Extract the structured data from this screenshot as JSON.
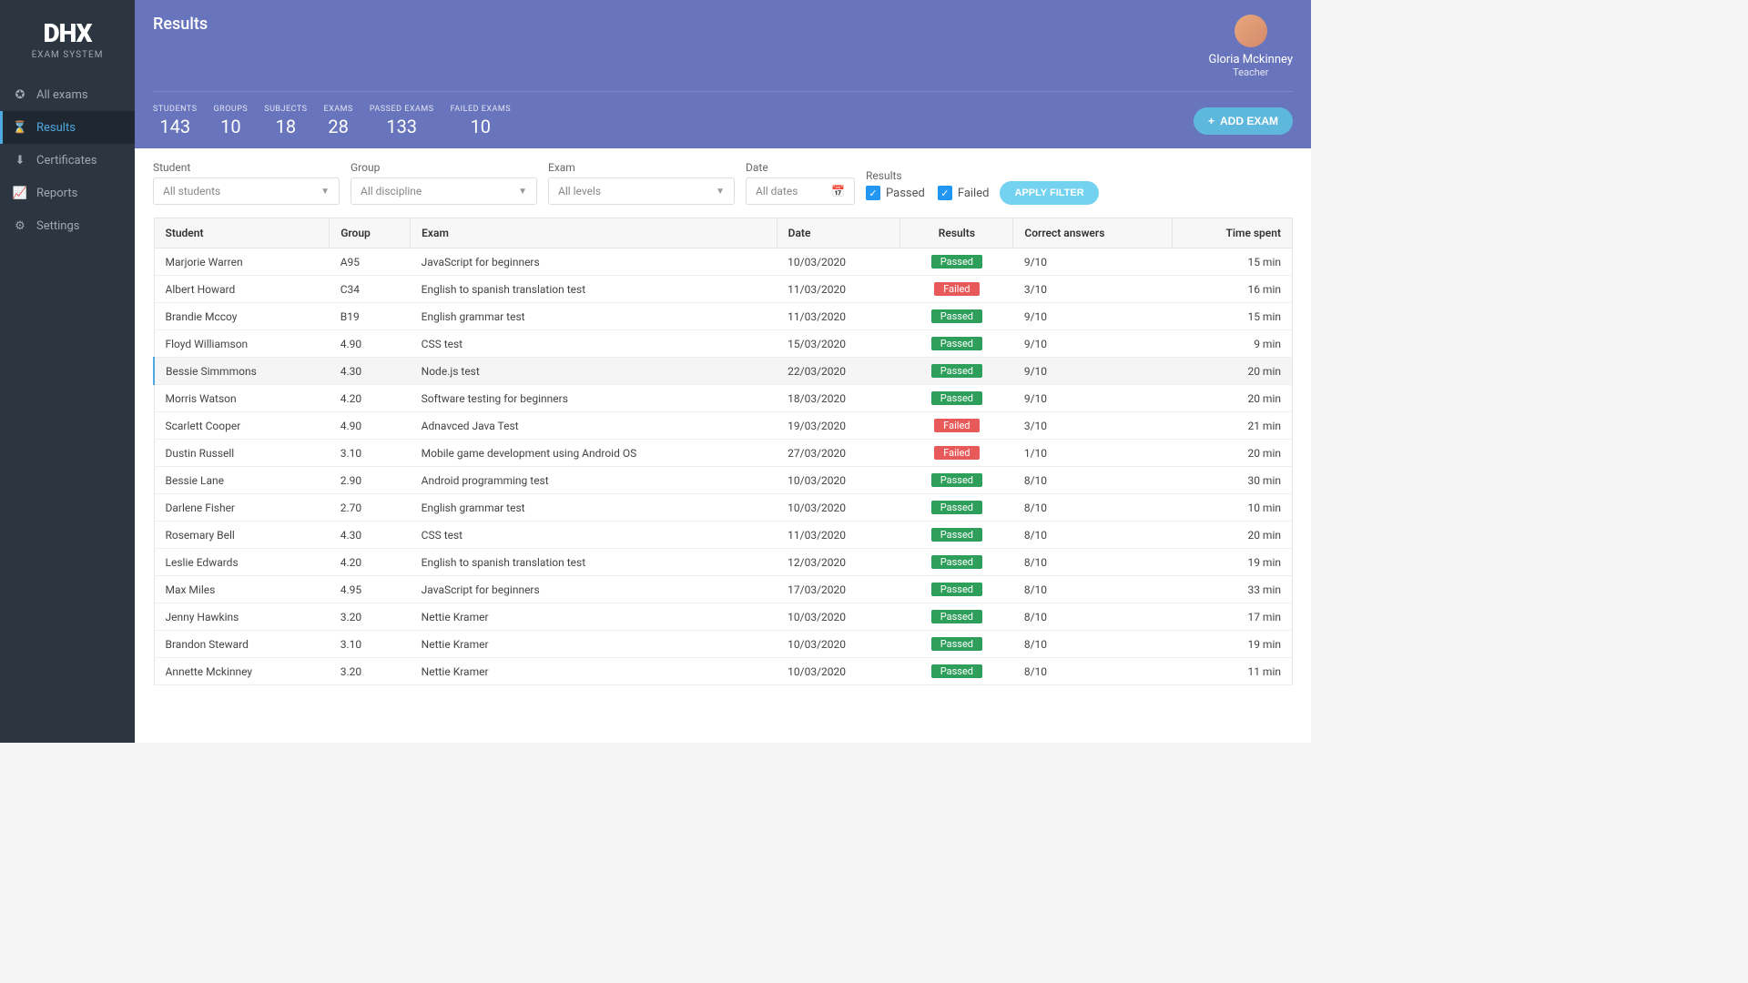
{
  "brand": {
    "logo": "DHX",
    "sub": "EXAM SYSTEM"
  },
  "nav": {
    "all_exams": "All exams",
    "results": "Results",
    "certificates": "Certificates",
    "reports": "Reports",
    "settings": "Settings"
  },
  "header": {
    "title": "Results",
    "add_exam": "ADD EXAM",
    "user": {
      "name": "Gloria Mckinney",
      "role": "Teacher"
    }
  },
  "stats": [
    {
      "label": "STUDENTS",
      "value": "143"
    },
    {
      "label": "GROUPS",
      "value": "10"
    },
    {
      "label": "SUBJECTS",
      "value": "18"
    },
    {
      "label": "EXAMS",
      "value": "28"
    },
    {
      "label": "PASSED EXAMS",
      "value": "133"
    },
    {
      "label": "FAILED EXAMS",
      "value": "10"
    }
  ],
  "filters": {
    "student": {
      "label": "Student",
      "value": "All students"
    },
    "group": {
      "label": "Group",
      "value": "All discipline"
    },
    "exam": {
      "label": "Exam",
      "value": "All levels"
    },
    "date": {
      "label": "Date",
      "value": "All dates"
    },
    "results": {
      "label": "Results",
      "passed": "Passed",
      "failed": "Failed"
    },
    "apply": "APPLY FILTER"
  },
  "table": {
    "headers": {
      "student": "Student",
      "group": "Group",
      "exam": "Exam",
      "date": "Date",
      "results": "Results",
      "correct": "Correct answers",
      "time": "Time spent"
    },
    "rows": [
      {
        "student": "Marjorie Warren",
        "group": "A95",
        "exam": "JavaScript for beginners",
        "date": "10/03/2020",
        "result": "Passed",
        "correct": "9/10",
        "time": "15 min"
      },
      {
        "student": "Albert Howard",
        "group": "C34",
        "exam": "English to spanish translation test",
        "date": "11/03/2020",
        "result": "Failed",
        "correct": "3/10",
        "time": "16 min"
      },
      {
        "student": "Brandie Mccoy",
        "group": "B19",
        "exam": "English grammar test",
        "date": "11/03/2020",
        "result": "Passed",
        "correct": "9/10",
        "time": "15 min"
      },
      {
        "student": "Floyd Williamson",
        "group": "4.90",
        "exam": "CSS test",
        "date": "15/03/2020",
        "result": "Passed",
        "correct": "9/10",
        "time": "9 min"
      },
      {
        "student": "Bessie Simmmons",
        "group": "4.30",
        "exam": "Node.js test",
        "date": "22/03/2020",
        "result": "Passed",
        "correct": "9/10",
        "time": "20 min",
        "highlight": true
      },
      {
        "student": "Morris Watson",
        "group": "4.20",
        "exam": "Software testing for beginners",
        "date": "18/03/2020",
        "result": "Passed",
        "correct": "9/10",
        "time": "20 min"
      },
      {
        "student": "Scarlett Cooper",
        "group": "4.90",
        "exam": "Adnavced Java Test",
        "date": "19/03/2020",
        "result": "Failed",
        "correct": "3/10",
        "time": "21 min"
      },
      {
        "student": "Dustin Russell",
        "group": "3.10",
        "exam": "Mobile game development using Android OS",
        "date": "27/03/2020",
        "result": "Failed",
        "correct": "1/10",
        "time": "20 min"
      },
      {
        "student": "Bessie Lane",
        "group": "2.90",
        "exam": "Android programming test",
        "date": "10/03/2020",
        "result": "Passed",
        "correct": "8/10",
        "time": "30 min"
      },
      {
        "student": "Darlene Fisher",
        "group": "2.70",
        "exam": "English grammar test",
        "date": "10/03/2020",
        "result": "Passed",
        "correct": "8/10",
        "time": "10 min"
      },
      {
        "student": "Rosemary Bell",
        "group": "4.30",
        "exam": "CSS test",
        "date": "11/03/2020",
        "result": "Passed",
        "correct": "8/10",
        "time": "20 min"
      },
      {
        "student": "Leslie Edwards",
        "group": "4.20",
        "exam": "English to spanish translation test",
        "date": "12/03/2020",
        "result": "Passed",
        "correct": "8/10",
        "time": "19 min"
      },
      {
        "student": "Max Miles",
        "group": "4.95",
        "exam": "JavaScript for beginners",
        "date": "17/03/2020",
        "result": "Passed",
        "correct": "8/10",
        "time": "33 min"
      },
      {
        "student": "Jenny Hawkins",
        "group": "3.20",
        "exam": "Nettie Kramer",
        "date": "10/03/2020",
        "result": "Passed",
        "correct": "8/10",
        "time": "17 min"
      },
      {
        "student": "Brandon Steward",
        "group": "3.10",
        "exam": "Nettie Kramer",
        "date": "10/03/2020",
        "result": "Passed",
        "correct": "8/10",
        "time": "19 min"
      },
      {
        "student": "Annette Mckinney",
        "group": "3.20",
        "exam": "Nettie Kramer",
        "date": "10/03/2020",
        "result": "Passed",
        "correct": "8/10",
        "time": "11 min"
      }
    ]
  }
}
